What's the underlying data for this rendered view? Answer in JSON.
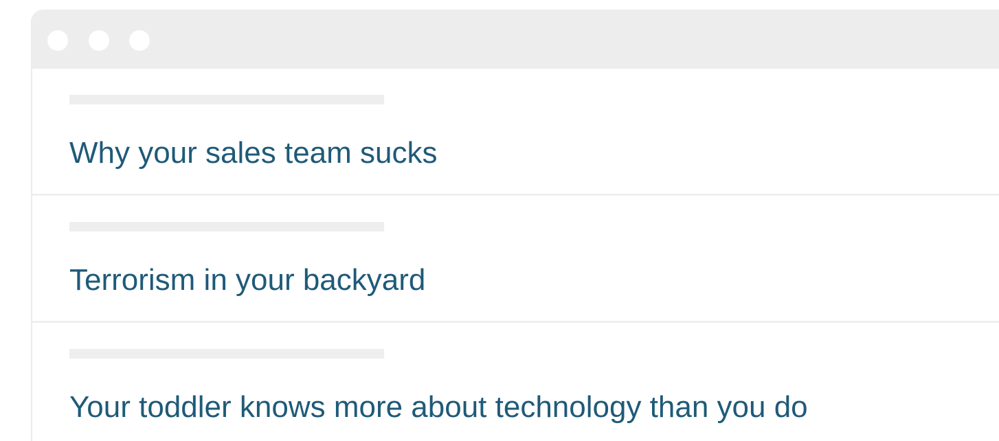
{
  "window": {
    "controls": [
      "window-dot",
      "window-dot",
      "window-dot"
    ]
  },
  "headlines": [
    {
      "title": "Why your sales team sucks"
    },
    {
      "title": "Terrorism in your backyard"
    },
    {
      "title": "Your toddler knows more about technology than you do"
    }
  ],
  "colors": {
    "headline_text": "#1f5a78",
    "titlebar": "#ecedec",
    "placeholder": "#eeeeee",
    "divider": "#eeefee"
  }
}
